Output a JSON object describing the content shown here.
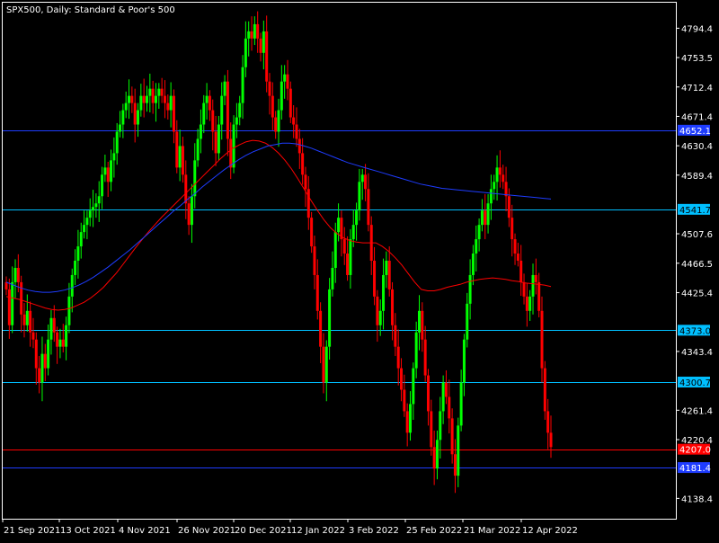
{
  "header": {
    "symbol_label": "SPX500, Daily:  Standard & Poor's 500"
  },
  "colors": {
    "background": "#000000",
    "frame": "#ffffff",
    "bull": "#00ff00",
    "bear": "#ff0000",
    "ma_fast": "#ff0000",
    "ma_slow": "#1e3cff",
    "level_blue": "#1e3cff",
    "level_cyan": "#00bfff",
    "level_red": "#ff0000",
    "text": "#ffffff"
  },
  "chart_data": {
    "type": "candlestick",
    "title": "SPX500, Daily:  Standard & Poor's 500",
    "y_ticks": [
      "4794.4",
      "4753.5",
      "4712.4",
      "4671.4",
      "4630.4",
      "4589.4",
      "4507.6",
      "4466.5",
      "4425.4",
      "4343.4",
      "4261.4",
      "4220.4",
      "4138.4"
    ],
    "ylim": [
      4110,
      4830
    ],
    "x_ticks": [
      "21 Sep 2021",
      "13 Oct 2021",
      "4 Nov 2021",
      "26 Nov 2021",
      "20 Dec 2021",
      "12 Jan 2022",
      "3 Feb 2022",
      "25 Feb 2022",
      "21 Mar 2022",
      "12 Apr 2022"
    ],
    "levels": [
      {
        "value": 4652.1,
        "label": "4652.1",
        "kind": "blue"
      },
      {
        "value": 4541.7,
        "label": "4541.7",
        "kind": "cyan"
      },
      {
        "value": 4373.0,
        "label": "4373.0",
        "kind": "cyan"
      },
      {
        "value": 4300.7,
        "label": "4300.7",
        "kind": "cyan"
      },
      {
        "value": 4207.0,
        "label": "4207.0",
        "kind": "red"
      },
      {
        "value": 4181.4,
        "label": "4181.4",
        "kind": "blue"
      }
    ],
    "closes": [
      4430,
      4380,
      4440,
      4460,
      4440,
      4395,
      4380,
      4400,
      4370,
      4360,
      4320,
      4300,
      4340,
      4320,
      4360,
      4390,
      4370,
      4350,
      4360,
      4350,
      4380,
      4420,
      4450,
      4470,
      4490,
      4510,
      4520,
      4530,
      4540,
      4545,
      4550,
      4560,
      4590,
      4600,
      4580,
      4610,
      4620,
      4650,
      4660,
      4680,
      4690,
      4700,
      4690,
      4660,
      4680,
      4700,
      4690,
      4700,
      4710,
      4690,
      4700,
      4710,
      4700,
      4690,
      4680,
      4700,
      4650,
      4600,
      4630,
      4590,
      4550,
      4520,
      4560,
      4610,
      4640,
      4660,
      4690,
      4700,
      4680,
      4650,
      4620,
      4660,
      4700,
      4720,
      4640,
      4600,
      4660,
      4670,
      4690,
      4740,
      4780,
      4790,
      4780,
      4800,
      4780,
      4760,
      4790,
      4720,
      4700,
      4670,
      4650,
      4680,
      4720,
      4730,
      4710,
      4670,
      4660,
      4640,
      4620,
      4590,
      4570,
      4530,
      4490,
      4450,
      4400,
      4350,
      4300,
      4350,
      4430,
      4460,
      4510,
      4530,
      4500,
      4480,
      4450,
      4500,
      4520,
      4540,
      4580,
      4590,
      4570,
      4520,
      4470,
      4420,
      4380,
      4400,
      4450,
      4470,
      4430,
      4380,
      4350,
      4320,
      4290,
      4260,
      4230,
      4270,
      4320,
      4370,
      4400,
      4360,
      4310,
      4260,
      4210,
      4180,
      4220,
      4260,
      4300,
      4280,
      4250,
      4200,
      4170,
      4240,
      4300,
      4360,
      4410,
      4450,
      4480,
      4500,
      4520,
      4540,
      4520,
      4550,
      4570,
      4580,
      4600,
      4590,
      4580,
      4560,
      4530,
      4500,
      4480,
      4470,
      4440,
      4420,
      4400,
      4420,
      4450,
      4440,
      4400,
      4320,
      4260,
      4230,
      4210
    ],
    "ma_fast": [
      4420,
      4418,
      4416,
      4413,
      4410,
      4407,
      4404,
      4402,
      4401,
      4402,
      4404,
      4408,
      4412,
      4418,
      4425,
      4433,
      4443,
      4453,
      4465,
      4477,
      4489,
      4500,
      4511,
      4521,
      4531,
      4540,
      4549,
      4558,
      4567,
      4576,
      4585,
      4594,
      4603,
      4612,
      4620,
      4627,
      4632,
      4636,
      4638,
      4637,
      4634,
      4628,
      4620,
      4610,
      4598,
      4584,
      4569,
      4554,
      4540,
      4527,
      4516,
      4508,
      4502,
      4498,
      4496,
      4495,
      4495,
      4495,
      4490,
      4483,
      4474,
      4464,
      4452,
      4440,
      4430,
      4428,
      4428,
      4430,
      4433,
      4435,
      4437,
      4440,
      4442,
      4444,
      4445,
      4446,
      4445,
      4444,
      4442,
      4441,
      4439,
      4438,
      4437,
      4436,
      4434
    ],
    "ma_slow": [
      4440,
      4436,
      4432,
      4429,
      4427,
      4426,
      4426,
      4427,
      4429,
      4432,
      4436,
      4441,
      4447,
      4454,
      4461,
      4469,
      4477,
      4485,
      4494,
      4503,
      4512,
      4521,
      4530,
      4539,
      4547,
      4556,
      4564,
      4573,
      4581,
      4589,
      4597,
      4604,
      4611,
      4617,
      4622,
      4626,
      4630,
      4632,
      4634,
      4634,
      4633,
      4630,
      4627,
      4623,
      4619,
      4615,
      4611,
      4607,
      4604,
      4601,
      4598,
      4595,
      4592,
      4589,
      4586,
      4583,
      4580,
      4577,
      4575,
      4573,
      4571,
      4570,
      4569,
      4568,
      4567,
      4566,
      4565,
      4564,
      4563,
      4562,
      4561,
      4560,
      4559,
      4558,
      4557,
      4556
    ]
  }
}
